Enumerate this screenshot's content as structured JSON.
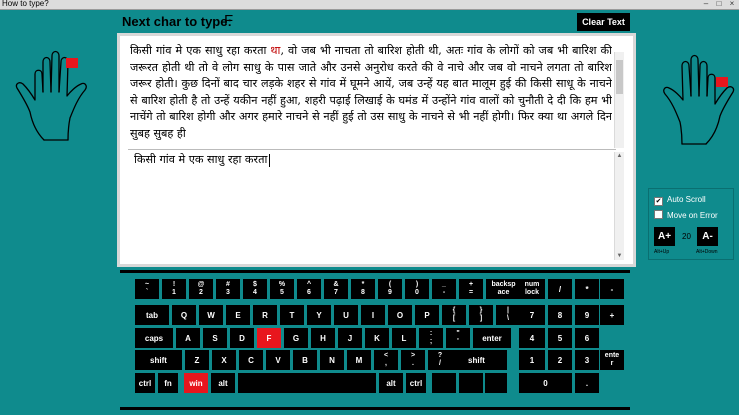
{
  "window": {
    "title": "How to type?"
  },
  "header": {
    "next_label": "Next char to type:",
    "next_char": "F",
    "clear_button": "Clear Text"
  },
  "source_text": {
    "before": "किसी गांव मे एक साधु रहा करता ",
    "current": "था",
    "after": ", वो जब भी नाचता तो बारिश होती थी, अतः गांव के लोगों को जब भी बारिश की जरूरत होती थी तो वे लोग साधु के पास जाते और उनसे अनुरोध करते की वे नाचे और जब वो नाचने लगता तो बारिश जरूर होती। कुछ दिनों बाद चार लड़के शहर से गांव में घूमने आयें, जब उन्हें यह बात मालूम हुई की किसी साधू के नाचने से बारिश होती है तो उन्हें यकीन नहीं हुआ, शहरी पढ़ाई लिखाई के घमंड में उन्होंने गांव वालों को चुनौती दे दी कि हम भी नाचेंगे तो बारिश होगी और अगर हमारे नाचने से नहीं हुई तो उस साधु के नाचने से भी नहीं होगी। फिर क्या था अगले दिन सुबह सुबह ही"
  },
  "typed_text": "किसी गांव मे एक साधु रहा करता",
  "options": {
    "auto_scroll": "Auto Scroll",
    "move_on_error": "Move on Error",
    "auto_scroll_checked": true,
    "move_on_error_checked": false
  },
  "font": {
    "increase": "A+",
    "decrease": "A-",
    "size": "20",
    "increase_hint": "Alt+Up",
    "decrease_hint": "Alt+Down"
  },
  "colors": {
    "background": "#0f8b8d",
    "active_key": "#e8161d",
    "current_char": "#c00000"
  },
  "keyboard": {
    "active_key": "F",
    "keys": [
      {
        "label": "~",
        "sub": "`"
      },
      {
        "label": "!",
        "sub": "1"
      },
      {
        "label": "@",
        "sub": "2"
      },
      {
        "label": "#",
        "sub": "3"
      },
      {
        "label": "$",
        "sub": "4"
      },
      {
        "label": "%",
        "sub": "5"
      },
      {
        "label": "^",
        "sub": "6"
      },
      {
        "label": "&",
        "sub": "7"
      },
      {
        "label": "*",
        "sub": "8"
      },
      {
        "label": "(",
        "sub": "9"
      },
      {
        "label": ")",
        "sub": "0"
      },
      {
        "label": "_",
        "sub": "-"
      },
      {
        "label": "+",
        "sub": "="
      },
      {
        "label": "backsp",
        "sub": "ace"
      },
      {
        "label": "tab"
      },
      {
        "label": "Q"
      },
      {
        "label": "W"
      },
      {
        "label": "E"
      },
      {
        "label": "R"
      },
      {
        "label": "T"
      },
      {
        "label": "Y"
      },
      {
        "label": "U"
      },
      {
        "label": "I"
      },
      {
        "label": "O"
      },
      {
        "label": "P"
      },
      {
        "label": "{",
        "sub": "["
      },
      {
        "label": "}",
        "sub": "]"
      },
      {
        "label": "|",
        "sub": "\\"
      },
      {
        "label": "caps"
      },
      {
        "label": "A"
      },
      {
        "label": "S"
      },
      {
        "label": "D"
      },
      {
        "label": "F"
      },
      {
        "label": "G"
      },
      {
        "label": "H"
      },
      {
        "label": "J"
      },
      {
        "label": "K"
      },
      {
        "label": "L"
      },
      {
        "label": ":",
        "sub": ";"
      },
      {
        "label": "\"",
        "sub": "'"
      },
      {
        "label": "enter"
      },
      {
        "label": "shift"
      },
      {
        "label": "Z"
      },
      {
        "label": "X"
      },
      {
        "label": "C"
      },
      {
        "label": "V"
      },
      {
        "label": "B"
      },
      {
        "label": "N"
      },
      {
        "label": "M"
      },
      {
        "label": "<",
        "sub": ","
      },
      {
        "label": ">",
        "sub": "."
      },
      {
        "label": "?",
        "sub": "/"
      },
      {
        "label": "shift"
      },
      {
        "label": "ctrl"
      },
      {
        "label": "fn"
      },
      {
        "label": "win"
      },
      {
        "label": "alt"
      },
      {
        "label": ""
      },
      {
        "label": "alt"
      },
      {
        "label": "ctrl"
      },
      {
        "label": ""
      },
      {
        "label": ""
      },
      {
        "label": ""
      },
      {
        "label": "num",
        "sub": "lock"
      },
      {
        "label": "/"
      },
      {
        "label": "*"
      },
      {
        "label": "-"
      },
      {
        "label": "7"
      },
      {
        "label": "8"
      },
      {
        "label": "9"
      },
      {
        "label": "+"
      },
      {
        "label": "4"
      },
      {
        "label": "5"
      },
      {
        "label": "6"
      },
      {
        "label": "1"
      },
      {
        "label": "2"
      },
      {
        "label": "3"
      },
      {
        "label": "ente",
        "sub": "r"
      },
      {
        "label": "0"
      },
      {
        "label": "."
      }
    ]
  }
}
